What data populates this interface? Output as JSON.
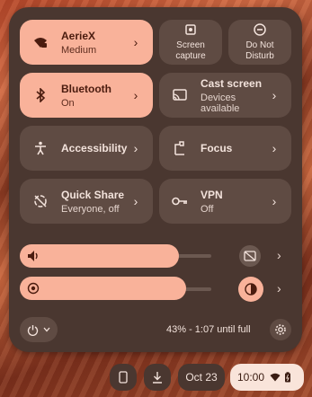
{
  "tiles": {
    "wifi": {
      "title": "AerieX",
      "subtitle": "Medium"
    },
    "screen_capture": {
      "label_line1": "Screen",
      "label_line2": "capture"
    },
    "do_not_disturb": {
      "label_line1": "Do Not",
      "label_line2": "Disturb"
    },
    "bluetooth": {
      "title": "Bluetooth",
      "subtitle": "On"
    },
    "cast": {
      "title": "Cast screen",
      "subtitle": "Devices available"
    },
    "accessibility": {
      "title": "Accessibility"
    },
    "focus": {
      "title": "Focus"
    },
    "quick_share": {
      "title": "Quick Share",
      "subtitle": "Everyone, off"
    },
    "vpn": {
      "title": "VPN",
      "subtitle": "Off"
    }
  },
  "sliders": {
    "volume": {
      "level": 0.83
    },
    "brightness": {
      "level": 0.87
    }
  },
  "footer": {
    "battery_text": "43% - 1:07 until full"
  },
  "shelf": {
    "date": "Oct 23",
    "time": "10:00"
  },
  "colors": {
    "accent": "#f9b29a",
    "panel": "#4a3730",
    "tile_off": "#5f4b43"
  }
}
